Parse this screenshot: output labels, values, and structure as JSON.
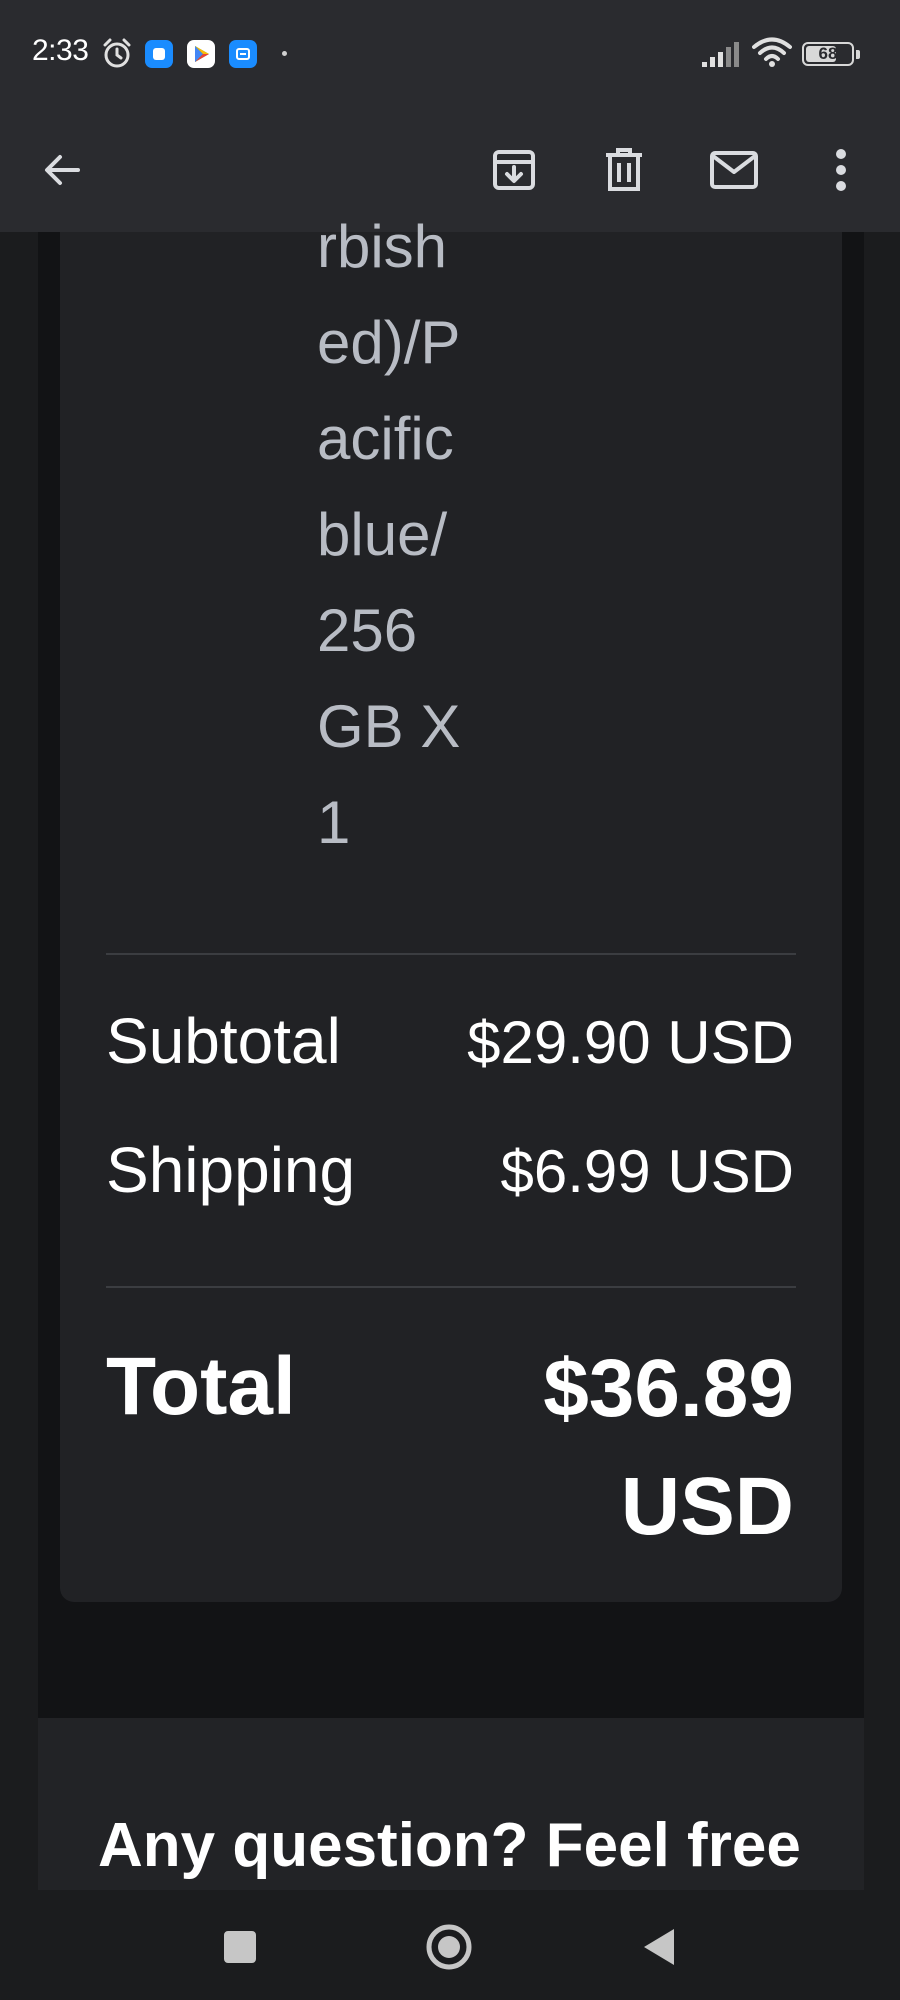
{
  "status_bar": {
    "time": "2:33",
    "battery": "68",
    "battery_level_percent": 68,
    "icons": [
      "alarm-icon",
      "app-icon-blue",
      "play-store-icon",
      "app-icon-blue-2",
      "signal-icon",
      "wifi-icon",
      "battery-icon"
    ]
  },
  "app_bar": {
    "back": "back-arrow-icon",
    "actions": [
      "archive-icon",
      "delete-icon",
      "mark-unread-icon",
      "more-options-icon"
    ]
  },
  "item": {
    "variant_lines": [
      "rbish",
      "ed)/P",
      "acific",
      "blue/",
      "256",
      "GB X",
      "1"
    ]
  },
  "summary": {
    "subtotal_label": "Subtotal",
    "subtotal_value": "$29.90 USD",
    "shipping_label": "Shipping",
    "shipping_value": "$6.99 USD",
    "total_label": "Total",
    "total_value": "$36.89 USD"
  },
  "footer": {
    "question_text": "Any question? Feel free"
  },
  "nav": {
    "buttons": [
      "recents-button",
      "home-button",
      "back-button"
    ]
  },
  "colors": {
    "app_bar_bg": "#2a2b2f",
    "card_bg": "#212225",
    "page_bg": "#121315",
    "muted_text": "#b8bcc4",
    "primary_text": "#ffffff",
    "accent_app": "#1a8cff"
  }
}
